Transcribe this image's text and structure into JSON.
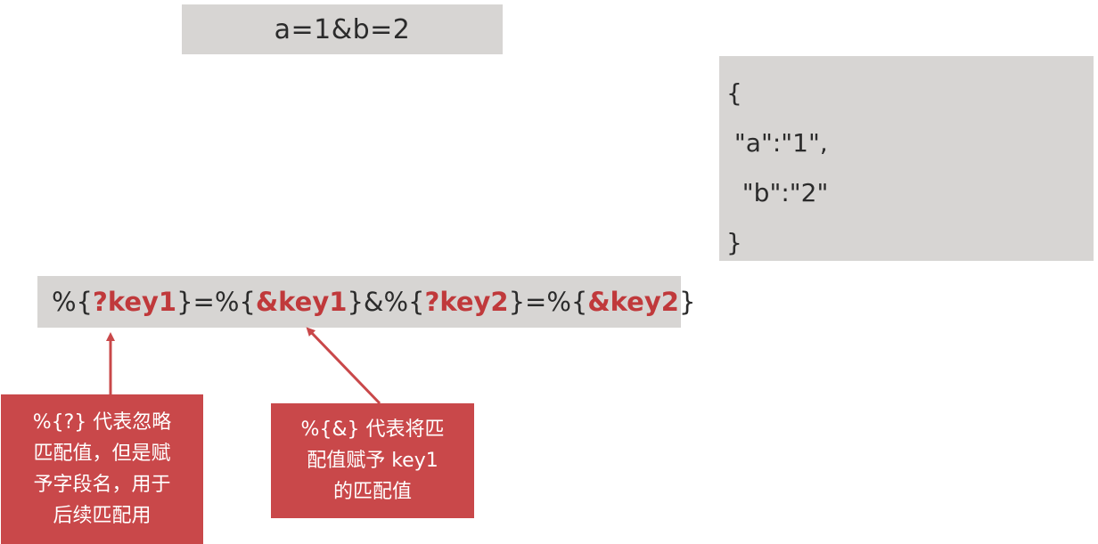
{
  "query": "a=1&b=2",
  "json_lines": [
    "{",
    " \"a\":\"1\",",
    "  \"b\":\"2\"",
    "}"
  ],
  "pattern": {
    "p1": "%{",
    "h1": "?key1",
    "p2": "}=%{",
    "h2": "&key1",
    "p3": "}&%{",
    "h3": "?key2",
    "p4": "}=%{",
    "h4": "&key2",
    "p5": "}"
  },
  "note_left": [
    "%{?} 代表忽略",
    "匹配值，但是赋",
    "予字段名，用于",
    "后续匹配用"
  ],
  "note_right": [
    "%{&} 代表将匹",
    "配值赋予 key1",
    "的匹配值"
  ],
  "colors": {
    "box_gray": "#d7d5d3",
    "highlight_red": "#c0393b",
    "note_red": "#c9484a",
    "arrow_red": "#c9484a"
  }
}
